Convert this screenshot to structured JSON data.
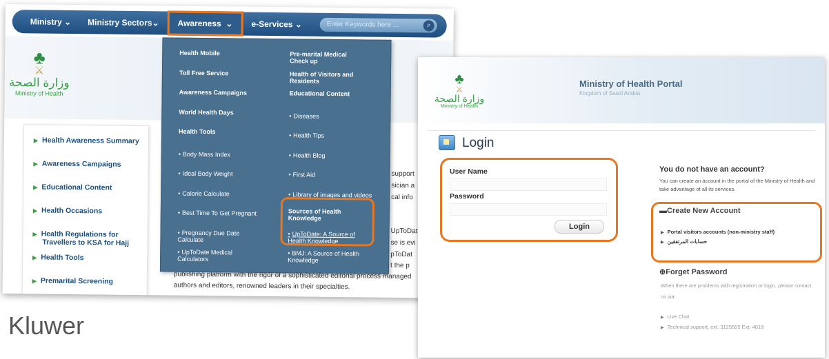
{
  "left": {
    "nav": [
      "Ministry",
      "Ministry Sectors",
      "Awareness",
      "e-Services"
    ],
    "search_placeholder": "Enter Keywords here ...",
    "logo": {
      "arabic": "وزارة الصحة",
      "english": "Ministry of Health"
    },
    "sidebar": [
      "Health Awareness Summary",
      "Awareness Campaigns",
      "Educational Content",
      "Health Occasions",
      "Health Regulations for Travellers to KSA for Hajj",
      "Health Tools",
      "Premarital Screening"
    ],
    "dropdown": {
      "col1": [
        "Health Mobile",
        "Toll Free Service",
        "Awareness Campaigns",
        "World Health Days",
        "Health Tools",
        "Body Mass Index",
        "Ideal Body Weight",
        "Calorie Calculate",
        "Best Time To Get Pregnant",
        "Pregnancy Due Date Calculate",
        "UpToDate Medical Calculators"
      ],
      "col2": [
        "Pre-marital Medical Check up",
        "Health of Visitors and Residents",
        "Educational Content",
        "Diseases",
        "Health Tips",
        "Health Blog",
        "First Aid",
        "Library of images and videos",
        "Sources of Health Knowledge",
        "UpToDate: A Source of Health Knowledge",
        "BMJ: A Source of Health Knowledge"
      ]
    },
    "body_fragments": [
      "support",
      "sician a",
      "se is evi",
      "cal info",
      "UpToDat",
      "pToDat",
      "t the p"
    ],
    "body_lines": [
      "publishing platform with the rigor of a sophisticated editorial process managed",
      "authors and editors, renowned leaders in their specialties."
    ],
    "caption": "Kluwer"
  },
  "right": {
    "logo": {
      "arabic": "وزارة الصحة",
      "english": "Ministry of Health"
    },
    "portal_title": "Ministry of Health Portal",
    "portal_subtitle": "Kingdom of Saudi Arabia",
    "login_title": "Login",
    "username_label": "User Name",
    "password_label": "Password",
    "login_button": "Login",
    "no_account_title": "You do not have an account?",
    "no_account_text": "You can create an account in the portal of the Ministry of Health and take advantage of all its services.",
    "create_account_title": "Create New Account",
    "create_links": [
      "Portal visitors accounts (non-ministry staff)",
      "حسابات المرتفقين"
    ],
    "forget_title": "Forget Password",
    "forget_text": "When there are problems with registration or login, please contact us via:",
    "forget_links": [
      "Live Chat",
      "Technical support, ext. 3125555 Ext: 4818"
    ]
  },
  "colors": {
    "highlight": "#e87722",
    "nav": "#1f4f80",
    "green": "#3aa047"
  }
}
